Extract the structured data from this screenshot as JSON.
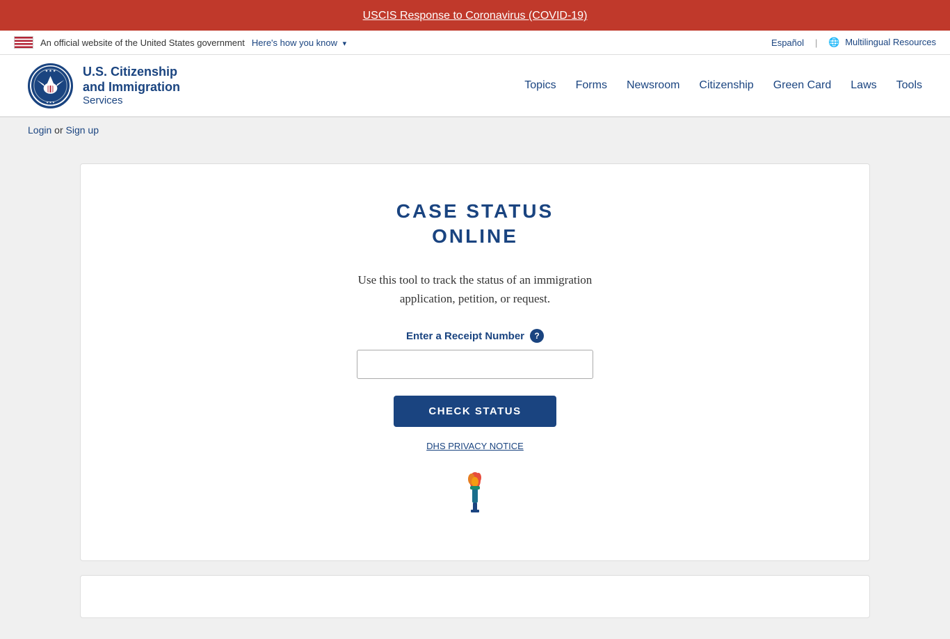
{
  "alert": {
    "text": "USCIS Response to Coronavirus (COVID-19)",
    "url": "#"
  },
  "govBanner": {
    "officialText": "An official website of the United States government",
    "howYouKnow": "Here's how you know",
    "espanol": "Español",
    "multilingualResources": "Multilingual Resources"
  },
  "header": {
    "logoAlt": "U.S. Department of Homeland Security Seal",
    "agencyLine1": "U.S. Citizenship",
    "agencyLine2": "and Immigration",
    "agencyLine3": "Services",
    "nav": {
      "topics": "Topics",
      "forms": "Forms",
      "newsroom": "Newsroom",
      "citizenship": "Citizenship",
      "greenCard": "Green Card",
      "laws": "Laws",
      "tools": "Tools"
    }
  },
  "loginBar": {
    "login": "Login",
    "or": "or",
    "signUp": "Sign up"
  },
  "caseStatus": {
    "title_line1": "CASE STATUS",
    "title_line2": "ONLINE",
    "description": "Use this tool to track the status of an immigration application, petition, or request.",
    "receiptLabel": "Enter a Receipt Number",
    "helpIcon": "?",
    "inputPlaceholder": "",
    "checkStatusBtn": "CHECK STATUS",
    "privacyNotice": "DHS PRIVACY NOTICE"
  },
  "bottomSection": {
    "visible": true
  }
}
